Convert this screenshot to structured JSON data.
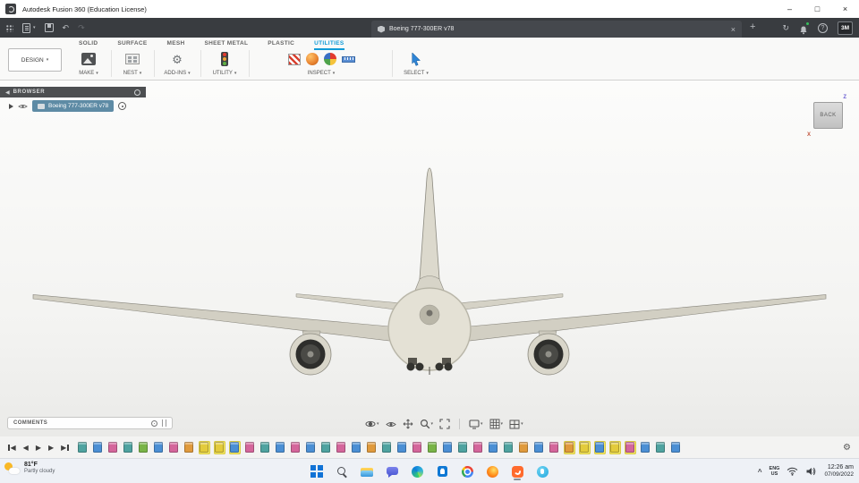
{
  "icons": {
    "minimize": "–",
    "maximize": "□",
    "close": "×",
    "undo": "↶",
    "redo": "↷",
    "sync": "↻",
    "help": "?",
    "new_tab": "+",
    "tab_close": "×",
    "caret": "▾",
    "collapse_left": "◀",
    "play_back": "◀",
    "play_fwd": "▶",
    "gear": "⚙",
    "chevron_up": "^"
  },
  "colors": {
    "accent_blue": "#0f9bd7",
    "selection_blue": "#5e8ba5",
    "timeline_highlight": "#f6ea67"
  },
  "titlebar": {
    "title": "Autodesk Fusion 360 (Education License)"
  },
  "tabbar": {
    "document_title": "Boeing 777-300ER v78",
    "avatar_initials": "3M"
  },
  "ribbon": {
    "design_label": "DESIGN",
    "tabs": [
      {
        "label": "SOLID",
        "active": false
      },
      {
        "label": "SURFACE",
        "active": false
      },
      {
        "label": "MESH",
        "active": false
      },
      {
        "label": "SHEET METAL",
        "active": false
      },
      {
        "label": "PLASTIC",
        "active": false
      },
      {
        "label": "UTILITIES",
        "active": true
      }
    ],
    "groups": [
      {
        "label": "MAKE"
      },
      {
        "label": "NEST"
      },
      {
        "label": "ADD-INS"
      },
      {
        "label": "UTILITY"
      },
      {
        "label": "INSPECT"
      },
      {
        "label": "SELECT"
      }
    ]
  },
  "browser": {
    "header": "BROWSER",
    "document_item": "Boeing 777-300ER v78"
  },
  "viewcube": {
    "face": "BACK",
    "axis_z": "Z",
    "axis_x": "X"
  },
  "comments": {
    "label": "COMMENTS"
  },
  "navbar": {
    "icons": [
      "orbit",
      "look-at",
      "pan",
      "zoom",
      "fit",
      "display-settings",
      "grid-snaps",
      "viewports"
    ]
  },
  "timeline": {
    "items": [
      {
        "c": "#4fa3a0",
        "h": false
      },
      {
        "c": "#4b8fd4",
        "h": false
      },
      {
        "c": "#d4669b",
        "h": false
      },
      {
        "c": "#4fa3a0",
        "h": false
      },
      {
        "c": "#79b447",
        "h": false
      },
      {
        "c": "#4b8fd4",
        "h": false
      },
      {
        "c": "#d4669b",
        "h": false
      },
      {
        "c": "#e09a3c",
        "h": false
      },
      {
        "c": "#e3cb3c",
        "h": true
      },
      {
        "c": "#e3cb3c",
        "h": true
      },
      {
        "c": "#4b8fd4",
        "h": true
      },
      {
        "c": "#d4669b",
        "h": false
      },
      {
        "c": "#4fa3a0",
        "h": false
      },
      {
        "c": "#4b8fd4",
        "h": false
      },
      {
        "c": "#d4669b",
        "h": false
      },
      {
        "c": "#4b8fd4",
        "h": false
      },
      {
        "c": "#4fa3a0",
        "h": false
      },
      {
        "c": "#d4669b",
        "h": false
      },
      {
        "c": "#4b8fd4",
        "h": false
      },
      {
        "c": "#e09a3c",
        "h": false
      },
      {
        "c": "#4fa3a0",
        "h": false
      },
      {
        "c": "#4b8fd4",
        "h": false
      },
      {
        "c": "#d4669b",
        "h": false
      },
      {
        "c": "#79b447",
        "h": false
      },
      {
        "c": "#4b8fd4",
        "h": false
      },
      {
        "c": "#4fa3a0",
        "h": false
      },
      {
        "c": "#d4669b",
        "h": false
      },
      {
        "c": "#4b8fd4",
        "h": false
      },
      {
        "c": "#4fa3a0",
        "h": false
      },
      {
        "c": "#e09a3c",
        "h": false
      },
      {
        "c": "#4b8fd4",
        "h": false
      },
      {
        "c": "#d4669b",
        "h": false
      },
      {
        "c": "#e09a3c",
        "h": true
      },
      {
        "c": "#e3cb3c",
        "h": true
      },
      {
        "c": "#4b8fd4",
        "h": true
      },
      {
        "c": "#e3cb3c",
        "h": true
      },
      {
        "c": "#d4669b",
        "h": true
      },
      {
        "c": "#4b8fd4",
        "h": false
      },
      {
        "c": "#4fa3a0",
        "h": false
      },
      {
        "c": "#4b8fd4",
        "h": false
      }
    ]
  },
  "taskbar": {
    "weather": {
      "temp": "81°F",
      "condition": "Partly cloudy"
    },
    "apps": [
      "start",
      "search",
      "file-explorer",
      "chat",
      "edge",
      "store",
      "chrome",
      "firefox",
      "fusion-360",
      "skype"
    ],
    "tray": {
      "lang_line1": "ENG",
      "lang_line2": "US",
      "time": "12:26 am",
      "date": "07/09/2022"
    }
  }
}
